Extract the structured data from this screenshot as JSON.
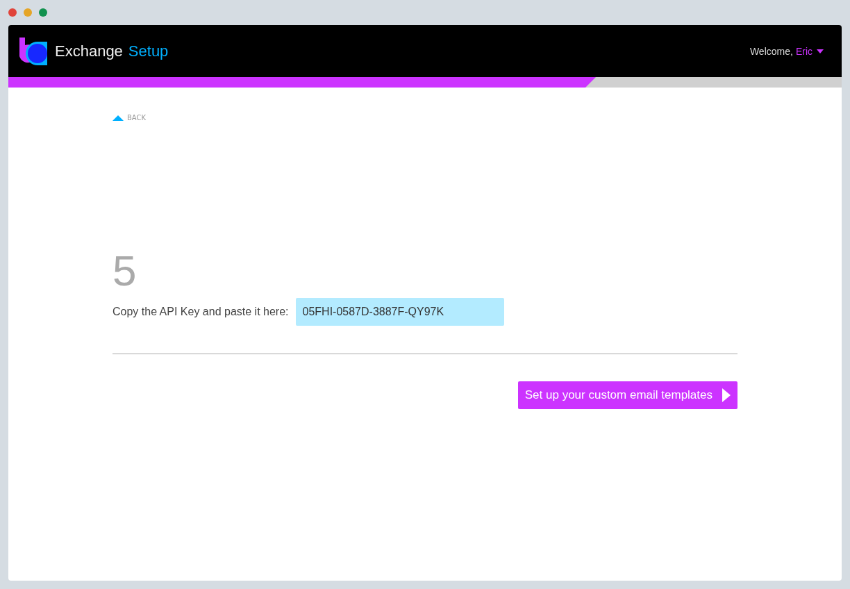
{
  "header": {
    "title": "Exchange",
    "title_accent": "Setup",
    "welcome": "Welcome,",
    "user": "Eric"
  },
  "progress": {
    "level": 0.705
  },
  "back": "BACK",
  "step": {
    "number": "5",
    "label": "Copy the API Key and paste it here:",
    "api_key": "05FHI-0587D-3887F-QY97K"
  },
  "next_button": "Set up your custom email templates"
}
